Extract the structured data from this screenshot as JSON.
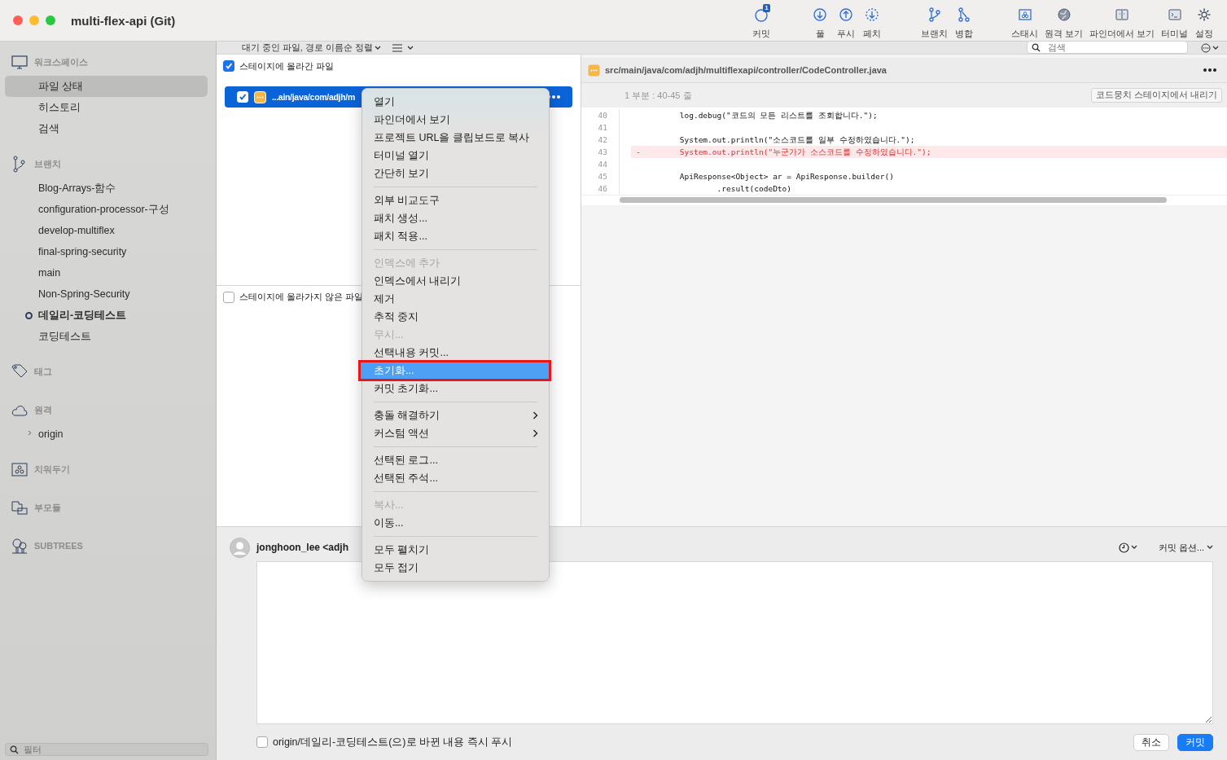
{
  "window": {
    "title": "multi-flex-api (Git)"
  },
  "toolbar": [
    {
      "label": "커밋",
      "badge": "1"
    },
    {
      "label": "풀"
    },
    {
      "label": "푸시"
    },
    {
      "label": "페치"
    },
    {
      "label": "브랜치"
    },
    {
      "label": "병합"
    },
    {
      "label": "스태시"
    },
    {
      "label": "원격 보기"
    },
    {
      "label": "파인더에서 보기"
    },
    {
      "label": "터미널"
    },
    {
      "label": "설정"
    }
  ],
  "search": {
    "placeholder": "검색"
  },
  "sidebar": {
    "sections": [
      {
        "title": "워크스페이스",
        "items": [
          {
            "label": "파일 상태",
            "selected": true
          },
          {
            "label": "히스토리",
            "selected": false
          },
          {
            "label": "검색",
            "selected": false
          }
        ]
      },
      {
        "title": "브랜치",
        "items": [
          {
            "label": "Blog-Arrays-함수",
            "selected": false,
            "current": false
          },
          {
            "label": "configuration-processor-구성",
            "selected": false,
            "current": false
          },
          {
            "label": "develop-multiflex",
            "selected": false,
            "current": false
          },
          {
            "label": "final-spring-security",
            "selected": false,
            "current": false
          },
          {
            "label": "main",
            "selected": false,
            "current": false
          },
          {
            "label": "Non-Spring-Security",
            "selected": false,
            "current": false
          },
          {
            "label": "데일리-코딩테스트",
            "selected": false,
            "current": true
          },
          {
            "label": "코딩테스트",
            "selected": false,
            "current": false
          }
        ]
      },
      {
        "title": "태그"
      },
      {
        "title": "원격",
        "items": [
          {
            "label": "origin",
            "selected": false,
            "expanded": false
          }
        ]
      },
      {
        "title": "치워두기"
      },
      {
        "title": "부모듈"
      },
      {
        "title": "SUBTREES"
      }
    ],
    "filter": {
      "placeholder": "필터"
    }
  },
  "files": {
    "sort_label": "대기 중인 파일, 경로 이름순 정렬",
    "staged": {
      "title": "스테이지에 올라간 파일",
      "checked": true,
      "files": [
        {
          "path": "...ain/java/com/adjh/m",
          "checked": true,
          "selected": true
        }
      ]
    },
    "unstaged": {
      "title": "스테이지에 올라가지 않은 파일",
      "checked": false
    }
  },
  "diff": {
    "path": "src/main/java/com/adjh/multiflexapi/controller/CodeController.java",
    "hunk": {
      "title": "1 부분 : 40-45 줄",
      "button": "코드뭉치 스테이지에서 내리기"
    },
    "lines": [
      {
        "number": "40",
        "kind": "context",
        "text": "        log.debug(\"코드의 모든 리스트를 조회합니다.\");"
      },
      {
        "number": "41",
        "kind": "context"
      },
      {
        "number": "42",
        "kind": "context",
        "text": "        System.out.println(\"소스코드를 일부 수정하였습니다.\");"
      },
      {
        "number": "43",
        "kind": "removed",
        "marker": "-",
        "text": "        System.out.println(\"누군가가 소스코드를 수정하였습니다.\");"
      },
      {
        "number": "44",
        "kind": "context"
      },
      {
        "number": "45",
        "kind": "context",
        "text": "        ApiResponse<Object> ar = ApiResponse.builder()"
      },
      {
        "number": "46",
        "kind": "context",
        "text": "                .result(codeDto)"
      }
    ]
  },
  "context_menu": {
    "items": [
      {
        "kind": "item",
        "label": "열기",
        "disabled": false,
        "selected": false
      },
      {
        "kind": "item",
        "label": "파인더에서 보기",
        "disabled": false,
        "selected": false
      },
      {
        "kind": "item",
        "label": "프로젝트 URL을 클립보드로 복사",
        "disabled": false,
        "selected": false
      },
      {
        "kind": "item",
        "label": "터미널 열기",
        "disabled": false,
        "selected": false
      },
      {
        "kind": "item",
        "label": "간단히 보기",
        "disabled": false,
        "selected": false
      },
      {
        "kind": "separator"
      },
      {
        "kind": "item",
        "label": "외부 비교도구",
        "disabled": false,
        "selected": false
      },
      {
        "kind": "item",
        "label": "패치 생성...",
        "disabled": false,
        "selected": false
      },
      {
        "kind": "item",
        "label": "패치 적용...",
        "disabled": false,
        "selected": false
      },
      {
        "kind": "separator"
      },
      {
        "kind": "item",
        "label": "인덱스에 추가",
        "disabled": true,
        "selected": false
      },
      {
        "kind": "item",
        "label": "인덱스에서 내리기",
        "disabled": false,
        "selected": false
      },
      {
        "kind": "item",
        "label": "제거",
        "disabled": false,
        "selected": false
      },
      {
        "kind": "item",
        "label": "추적 중지",
        "disabled": false,
        "selected": false
      },
      {
        "kind": "item",
        "label": "무시...",
        "disabled": true,
        "selected": false
      },
      {
        "kind": "item",
        "label": "선택내용 커밋...",
        "disabled": false,
        "selected": false
      },
      {
        "kind": "item",
        "label": "초기화...",
        "disabled": false,
        "selected": true
      },
      {
        "kind": "item",
        "label": "커밋 초기화...",
        "disabled": false,
        "selected": false
      },
      {
        "kind": "separator"
      },
      {
        "kind": "submenu",
        "label": "충돌 해결하기",
        "disabled": false,
        "selected": false
      },
      {
        "kind": "submenu",
        "label": "커스텀 액션",
        "disabled": false,
        "selected": false
      },
      {
        "kind": "separator"
      },
      {
        "kind": "item",
        "label": "선택된 로그...",
        "disabled": false,
        "selected": false
      },
      {
        "kind": "item",
        "label": "선택된 주석...",
        "disabled": false,
        "selected": false
      },
      {
        "kind": "separator"
      },
      {
        "kind": "item",
        "label": "복사...",
        "disabled": true,
        "selected": false
      },
      {
        "kind": "item",
        "label": "이동...",
        "disabled": false,
        "selected": false
      },
      {
        "kind": "separator"
      },
      {
        "kind": "item",
        "label": "모두 펼치기",
        "disabled": false,
        "selected": false
      },
      {
        "kind": "item",
        "label": "모두 접기",
        "disabled": false,
        "selected": false
      }
    ]
  },
  "commit": {
    "author": "jonghoon_lee <adjh",
    "options_label": "커밋 옵션...",
    "push_option": {
      "label": "origin/데일리-코딩테스트(으)로 바뀐 내용 즉시 푸시",
      "checked": false
    },
    "buttons": [
      {
        "kind": "secondary",
        "label": "취소"
      },
      {
        "kind": "primary",
        "label": "커밋"
      }
    ]
  }
}
